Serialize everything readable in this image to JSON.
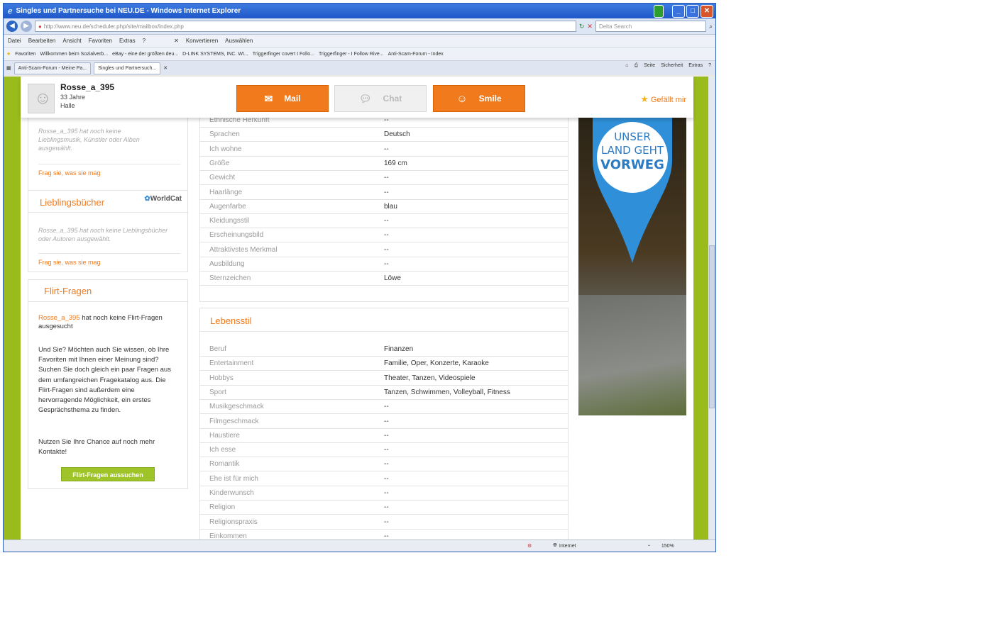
{
  "browser": {
    "title": "Singles und Partnersuche bei NEU.DE - Windows Internet Explorer",
    "address": "http://www.neu.de/scheduler.php/site/mailbox/index.php",
    "address_domain": "neu.de",
    "search_placeholder": "Delta Search",
    "menu": [
      "Datei",
      "Bearbeiten",
      "Ansicht",
      "Favoriten",
      "Extras",
      "?"
    ],
    "toolbar_tools": [
      "Konvertieren",
      "Auswählen"
    ],
    "favorites_label": "Favoriten",
    "favorites": [
      "Willkommen beim Sozialverb...",
      "eBay - eine der größten deu...",
      "D-LINK SYSTEMS, INC. WI...",
      "Triggerfinger covert I Follo...",
      "Triggerfinger - I Follow Rive...",
      "Anti-Scam-Forum - Index"
    ],
    "tabs": [
      "Anti-Scam-Forum - Meine Pa...",
      "Singles und Partnersuch..."
    ],
    "commands": [
      "Seite",
      "Sicherheit",
      "Extras"
    ],
    "status_zone": "Internet",
    "zoom": "150%"
  },
  "profile": {
    "name": "Rosse_a_395",
    "age": "33 Jahre",
    "city": "Halle",
    "mail_label": "Mail",
    "chat_label": "Chat",
    "smile_label": "Smile",
    "like_label": "Gefällt mir"
  },
  "sidebar": {
    "music_text": "Rosse_a_395 hat noch keine Lieblingsmusik, Künstler oder Alben ausgewählt.",
    "music_link": "Frag sie, was sie mag",
    "books_title": "Lieblingsbücher",
    "worldcat": "WorldCat",
    "books_text": "Rosse_a_395 hat noch keine Lieblingsbücher oder Autoren ausgewählt.",
    "books_link": "Frag sie, was sie mag",
    "flirt_title": "Flirt-Fragen",
    "flirt_name": "Rosse_a_395",
    "flirt_text1": "hat noch keine Flirt-Fragen ausgesucht",
    "flirt_text2": "Und Sie? Möchten auch Sie wissen, ob Ihre Favoriten mit Ihnen einer Meinung sind? Suchen Sie doch gleich ein paar Fragen aus dem umfangreichen Fragekatalog aus. Die Flirt-Fragen sind außerdem eine hervorragende Möglichkeit, ein erstes Gesprächsthema zu finden.",
    "flirt_text3": "Nutzen Sie Ihre Chance auf noch mehr Kontakte!",
    "flirt_button": "Flirt-Fragen aussuchen"
  },
  "appearance_rows": [
    {
      "k": "Ethnische Herkunft",
      "v": "--"
    },
    {
      "k": "Sprachen",
      "v": "Deutsch"
    },
    {
      "k": "Ich wohne",
      "v": "--"
    },
    {
      "k": "Größe",
      "v": "169 cm"
    },
    {
      "k": "Gewicht",
      "v": "--"
    },
    {
      "k": "Haarlänge",
      "v": "--"
    },
    {
      "k": "Augenfarbe",
      "v": "blau"
    },
    {
      "k": "Kleidungsstil",
      "v": "--"
    },
    {
      "k": "Erscheinungsbild",
      "v": "--"
    },
    {
      "k": "Attraktivstes Merkmal",
      "v": "--"
    },
    {
      "k": "Ausbildung",
      "v": "--"
    },
    {
      "k": "Sternzeichen",
      "v": "Löwe"
    }
  ],
  "lifestyle": {
    "title": "Lebensstil",
    "rows": [
      {
        "k": "Beruf",
        "v": "Finanzen"
      },
      {
        "k": "Entertainment",
        "v": "Familie, Oper, Konzerte, Karaoke"
      },
      {
        "k": "Hobbys",
        "v": "Theater, Tanzen, Videospiele"
      },
      {
        "k": "Sport",
        "v": "Tanzen, Schwimmen, Volleyball, Fitness"
      },
      {
        "k": "Musikgeschmack",
        "v": "--"
      },
      {
        "k": "Filmgeschmack",
        "v": "--"
      },
      {
        "k": "Haustiere",
        "v": "--"
      },
      {
        "k": "Ich esse",
        "v": "--"
      },
      {
        "k": "Romantik",
        "v": "--"
      },
      {
        "k": "Ehe ist für mich",
        "v": "--"
      },
      {
        "k": "Kinderwunsch",
        "v": "--"
      },
      {
        "k": "Religion",
        "v": "--"
      },
      {
        "k": "Religionspraxis",
        "v": "--"
      },
      {
        "k": "Einkommen",
        "v": "--"
      }
    ]
  },
  "ad": {
    "line1": "UNSER",
    "line2": "LAND GEHT",
    "line3": "VORWEG"
  },
  "colors": {
    "accent": "#f07a1c",
    "green_frame": "#9abb1c",
    "flirt_button": "#9ec42a"
  }
}
